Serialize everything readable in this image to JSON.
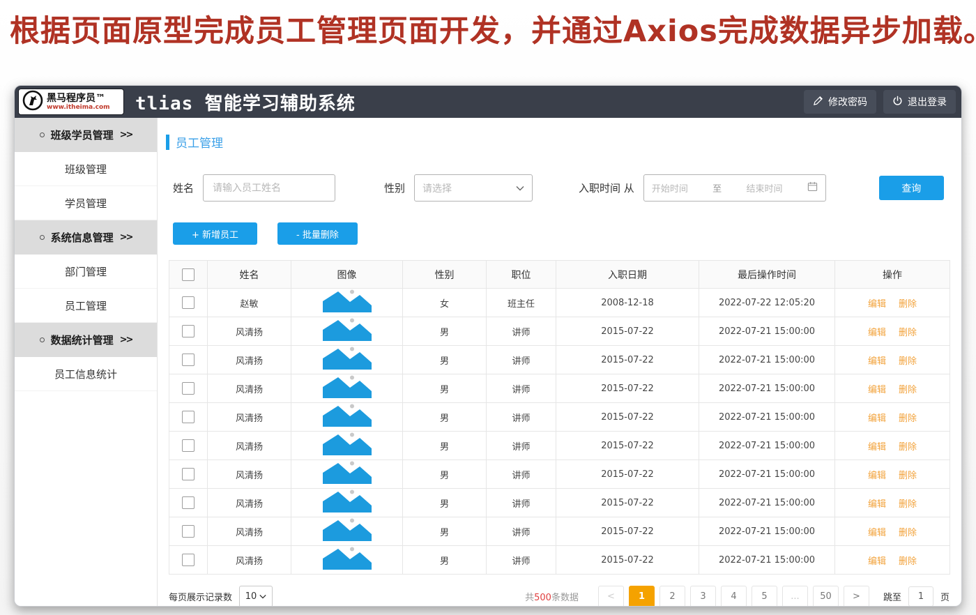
{
  "heading": "根据页面原型完成员工管理页面开发，并通过Axios完成数据异步加载。",
  "colors": {
    "accent": "#1a9ee8",
    "orange": "#f2a33c",
    "active-page": "#f5a200",
    "red": "#b03224",
    "header-bg": "#3a3f4a",
    "group-bg": "#dcdcdc"
  },
  "header": {
    "logo_brand": "黑马程序员™",
    "logo_url": "www.itheima.com",
    "title": "tlias 智能学习辅助系统",
    "change_password": "修改密码",
    "logout": "退出登录"
  },
  "sidebar": {
    "bullet": "",
    "arrow": ">>",
    "groups": [
      {
        "label": "班级学员管理",
        "items": [
          "班级管理",
          "学员管理"
        ]
      },
      {
        "label": "系统信息管理",
        "items": [
          "部门管理",
          "员工管理"
        ]
      },
      {
        "label": "数据统计管理",
        "items": [
          "员工信息统计"
        ]
      }
    ]
  },
  "main": {
    "page_title": "员工管理",
    "filters": {
      "name_label": "姓名",
      "name_placeholder": "请输入员工姓名",
      "gender_label": "性别",
      "gender_placeholder": "请选择",
      "hire_label": "入职时间 从",
      "start_placeholder": "开始时间",
      "range_separator": "至",
      "end_placeholder": "结束时间",
      "search_button": "查询"
    },
    "actions": {
      "add": "+ 新增员工",
      "batch_delete": "- 批量删除"
    },
    "table": {
      "headers": [
        "姓名",
        "图像",
        "性别",
        "职位",
        "入职日期",
        "最后操作时间",
        "操作"
      ],
      "edit_label": "编辑",
      "delete_label": "删除",
      "rows": [
        {
          "name": "赵敏",
          "gender": "女",
          "position": "班主任",
          "hire_date": "2008-12-18",
          "last_op": "2022-07-22 12:05:20"
        },
        {
          "name": "风清扬",
          "gender": "男",
          "position": "讲师",
          "hire_date": "2015-07-22",
          "last_op": "2022-07-21 15:00:00"
        },
        {
          "name": "风清扬",
          "gender": "男",
          "position": "讲师",
          "hire_date": "2015-07-22",
          "last_op": "2022-07-21 15:00:00"
        },
        {
          "name": "风清扬",
          "gender": "男",
          "position": "讲师",
          "hire_date": "2015-07-22",
          "last_op": "2022-07-21 15:00:00"
        },
        {
          "name": "风清扬",
          "gender": "男",
          "position": "讲师",
          "hire_date": "2015-07-22",
          "last_op": "2022-07-21 15:00:00"
        },
        {
          "name": "风清扬",
          "gender": "男",
          "position": "讲师",
          "hire_date": "2015-07-22",
          "last_op": "2022-07-21 15:00:00"
        },
        {
          "name": "风清扬",
          "gender": "男",
          "position": "讲师",
          "hire_date": "2015-07-22",
          "last_op": "2022-07-21 15:00:00"
        },
        {
          "name": "风清扬",
          "gender": "男",
          "position": "讲师",
          "hire_date": "2015-07-22",
          "last_op": "2022-07-21 15:00:00"
        },
        {
          "name": "风清扬",
          "gender": "男",
          "position": "讲师",
          "hire_date": "2015-07-22",
          "last_op": "2022-07-21 15:00:00"
        },
        {
          "name": "风清扬",
          "gender": "男",
          "position": "讲师",
          "hire_date": "2015-07-22",
          "last_op": "2022-07-21 15:00:00"
        }
      ]
    },
    "pagination": {
      "page_size_label": "每页展示记录数",
      "page_size": "10",
      "total_prefix": "共",
      "total_count": "500",
      "total_suffix": "条数据",
      "pages": [
        "<",
        "1",
        "2",
        "3",
        "4",
        "5",
        "...",
        "50",
        ">"
      ],
      "active_page": "1",
      "jump_label": "跳至",
      "jump_value": "1",
      "jump_suffix": "页"
    }
  }
}
